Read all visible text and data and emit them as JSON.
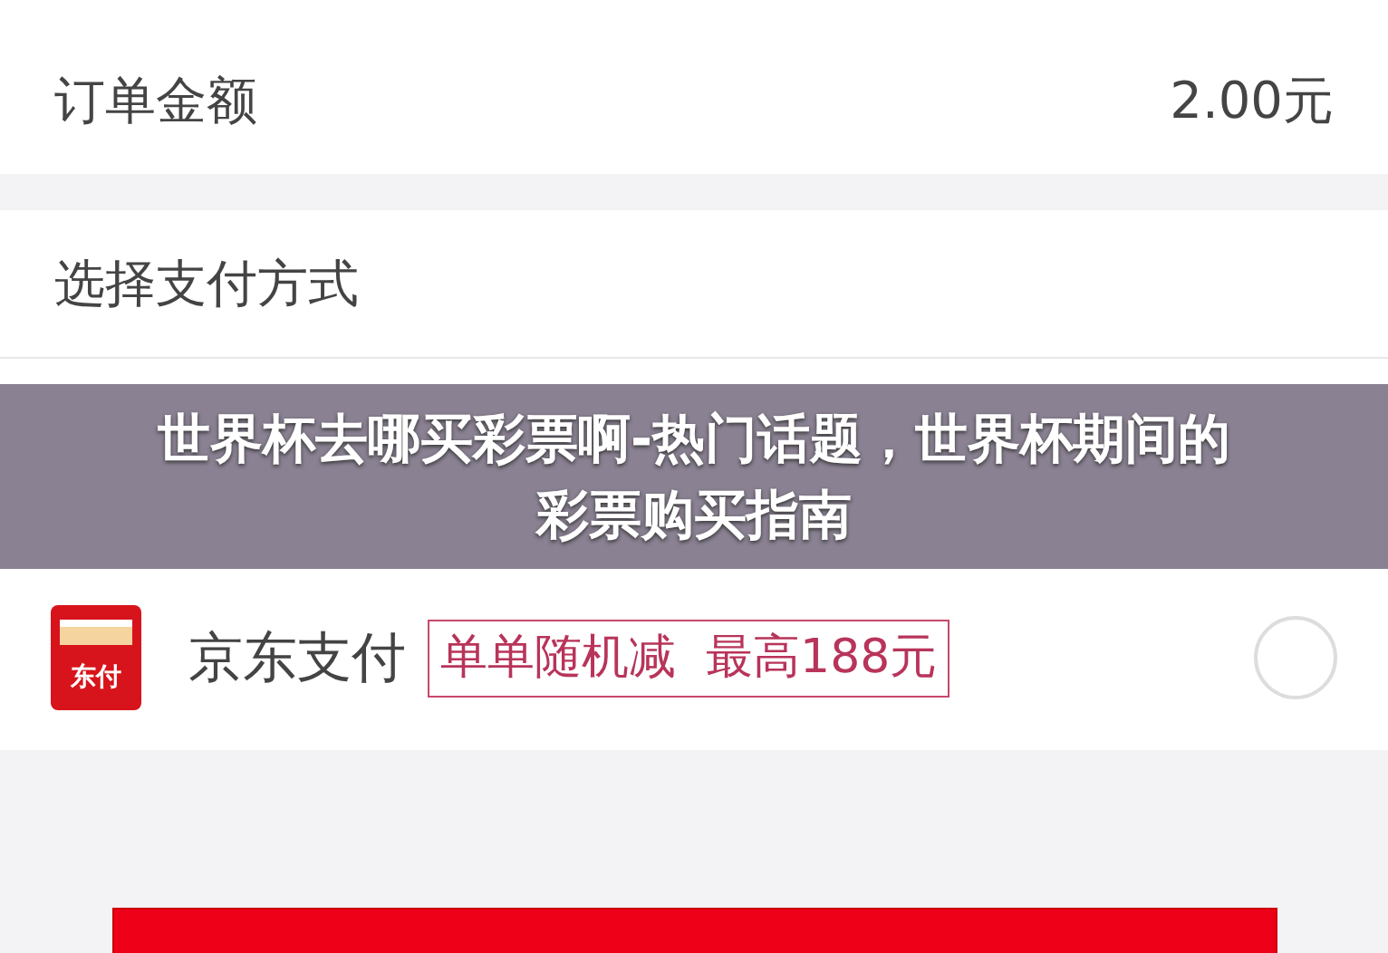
{
  "order": {
    "label": "订单金额",
    "amount": "2.00元"
  },
  "payment_section": {
    "title": "选择支付方式"
  },
  "payment_methods": [
    {
      "kind": "jd",
      "name": "京东支付",
      "icon_text": "东付",
      "promo": "单单随机减  最高188元",
      "selected": false
    }
  ],
  "caption": {
    "text": "世界杯去哪买彩票啊-热门话题，世界杯期间的彩票购买指南"
  }
}
